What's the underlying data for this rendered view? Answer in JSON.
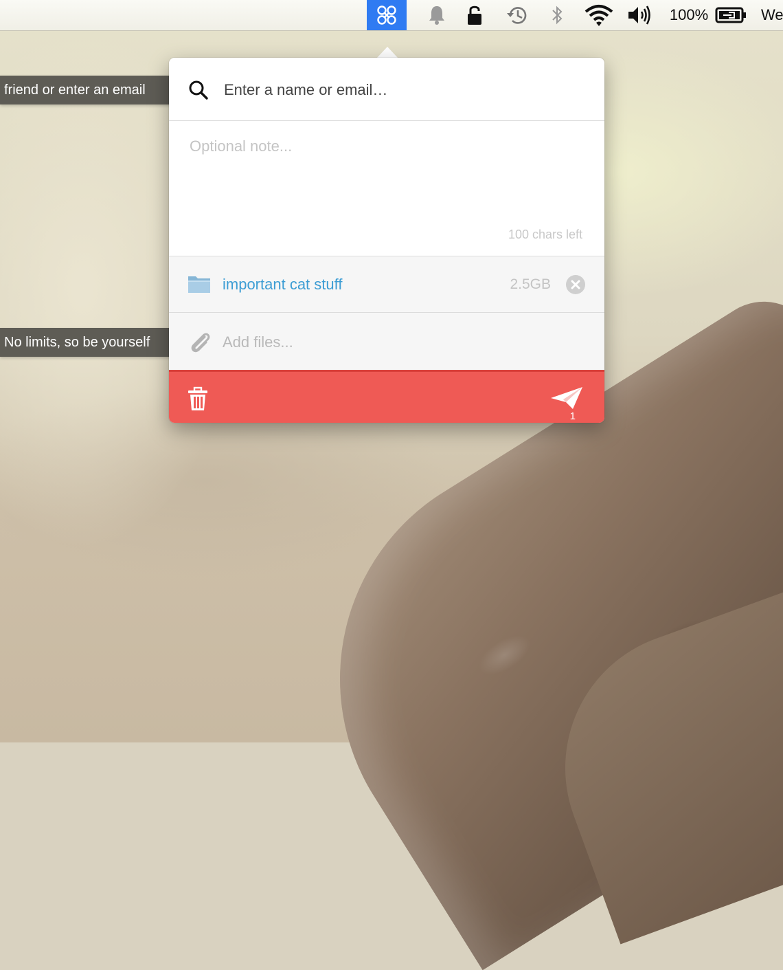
{
  "menubar": {
    "battery_label": "100%",
    "clock_partial": "We",
    "icons": [
      "app-icon",
      "bell-icon",
      "lock-icon",
      "time-machine-icon",
      "bluetooth-icon",
      "wifi-icon",
      "volume-icon",
      "battery-icon"
    ],
    "app_accent": "#2f7bf2"
  },
  "tooltips": {
    "search_tip": "friend or enter an email",
    "files_tip": "No limits, so be yourself"
  },
  "popover": {
    "search": {
      "placeholder": "Enter a name or email…",
      "value": ""
    },
    "note": {
      "placeholder": "Optional note...",
      "chars_left": "100 chars left"
    },
    "file": {
      "name": "important cat stuff",
      "size": "2.5GB"
    },
    "add_files_label": "Add files...",
    "footer": {
      "send_count": "1",
      "accent": "#ef5a55"
    }
  }
}
